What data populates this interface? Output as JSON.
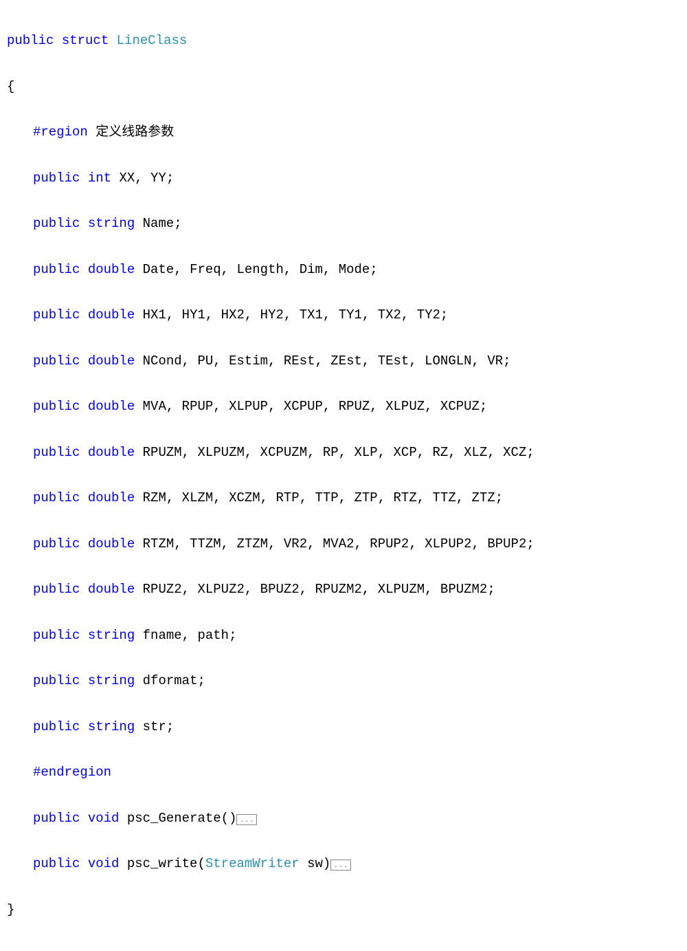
{
  "code": {
    "line1_kw1": "public",
    "line1_kw2": "struct",
    "line1_type": "LineClass",
    "brace_open": "{",
    "region_start": "#region",
    "region_label": " 定义线路参数",
    "pub": "public",
    "int_kw": "int",
    "string_kw": "string",
    "double_kw": "double",
    "void_kw": "void",
    "l2_vars": " XX, YY;",
    "l3_vars": " Name;",
    "l4_vars": " Date, Freq, Length, Dim, Mode;",
    "l5_vars": " HX1, HY1, HX2, HY2, TX1, TY1, TX2, TY2;",
    "l6_vars": " NCond, PU, Estim, REst, ZEst, TEst, LONGLN, VR;",
    "l7_vars": " MVA, RPUP, XLPUP, XCPUP, RPUZ, XLPUZ, XCPUZ;",
    "l8_vars": " RPUZM, XLPUZM, XCPUZM, RP, XLP, XCP, RZ, XLZ, XCZ;",
    "l9_vars": " RZM, XLZM, XCZM, RTP, TTP, ZTP, RTZ, TTZ, ZTZ;",
    "l10_vars": " RTZM, TTZM, ZTZM, VR2, MVA2, RPUP2, XLPUP2, BPUP2;",
    "l11_vars": " RPUZ2, XLPUZ2, BPUZ2, RPUZM2, XLPUZM, BPUZM2;",
    "l12_vars": " fname, path;",
    "l13_vars": " dformat;",
    "l14_vars": " str;",
    "region_end": "#endregion",
    "m1_name": " psc_Generate()",
    "m2_name": " psc_write(",
    "m2_paramtype": "StreamWriter",
    "m2_paramname": " sw)",
    "collapse": "...",
    "brace_close": "}"
  }
}
